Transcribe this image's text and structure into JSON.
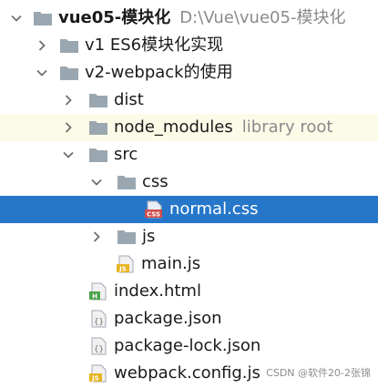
{
  "tree": {
    "root": {
      "label": "vue05-模块化",
      "path": "D:\\Vue\\vue05-模块化"
    },
    "v1_folder": "v1 ES6模块化实现",
    "v2_folder": "v2-webpack的使用",
    "dist": "dist",
    "node_modules": {
      "label": "node_modules",
      "hint": "library root"
    },
    "src": "src",
    "css": "css",
    "normal_css": "normal.css",
    "js": "js",
    "main_js": "main.js",
    "index_html": "index.html",
    "package_json": "package.json",
    "package_lock_json": "package-lock.json",
    "webpack_config_js": "webpack.config.js"
  },
  "icons": {
    "folder": "folder-icon",
    "css_file": "css-file-icon",
    "js_file": "js-file-icon",
    "html_file": "html-file-icon",
    "json_file": "json-file-icon"
  },
  "colors": {
    "selection": "#2677c9",
    "library_row": "#fbfbe8",
    "hint": "#8a8a8a"
  },
  "watermark": "CSDN @软件20-2张锦"
}
